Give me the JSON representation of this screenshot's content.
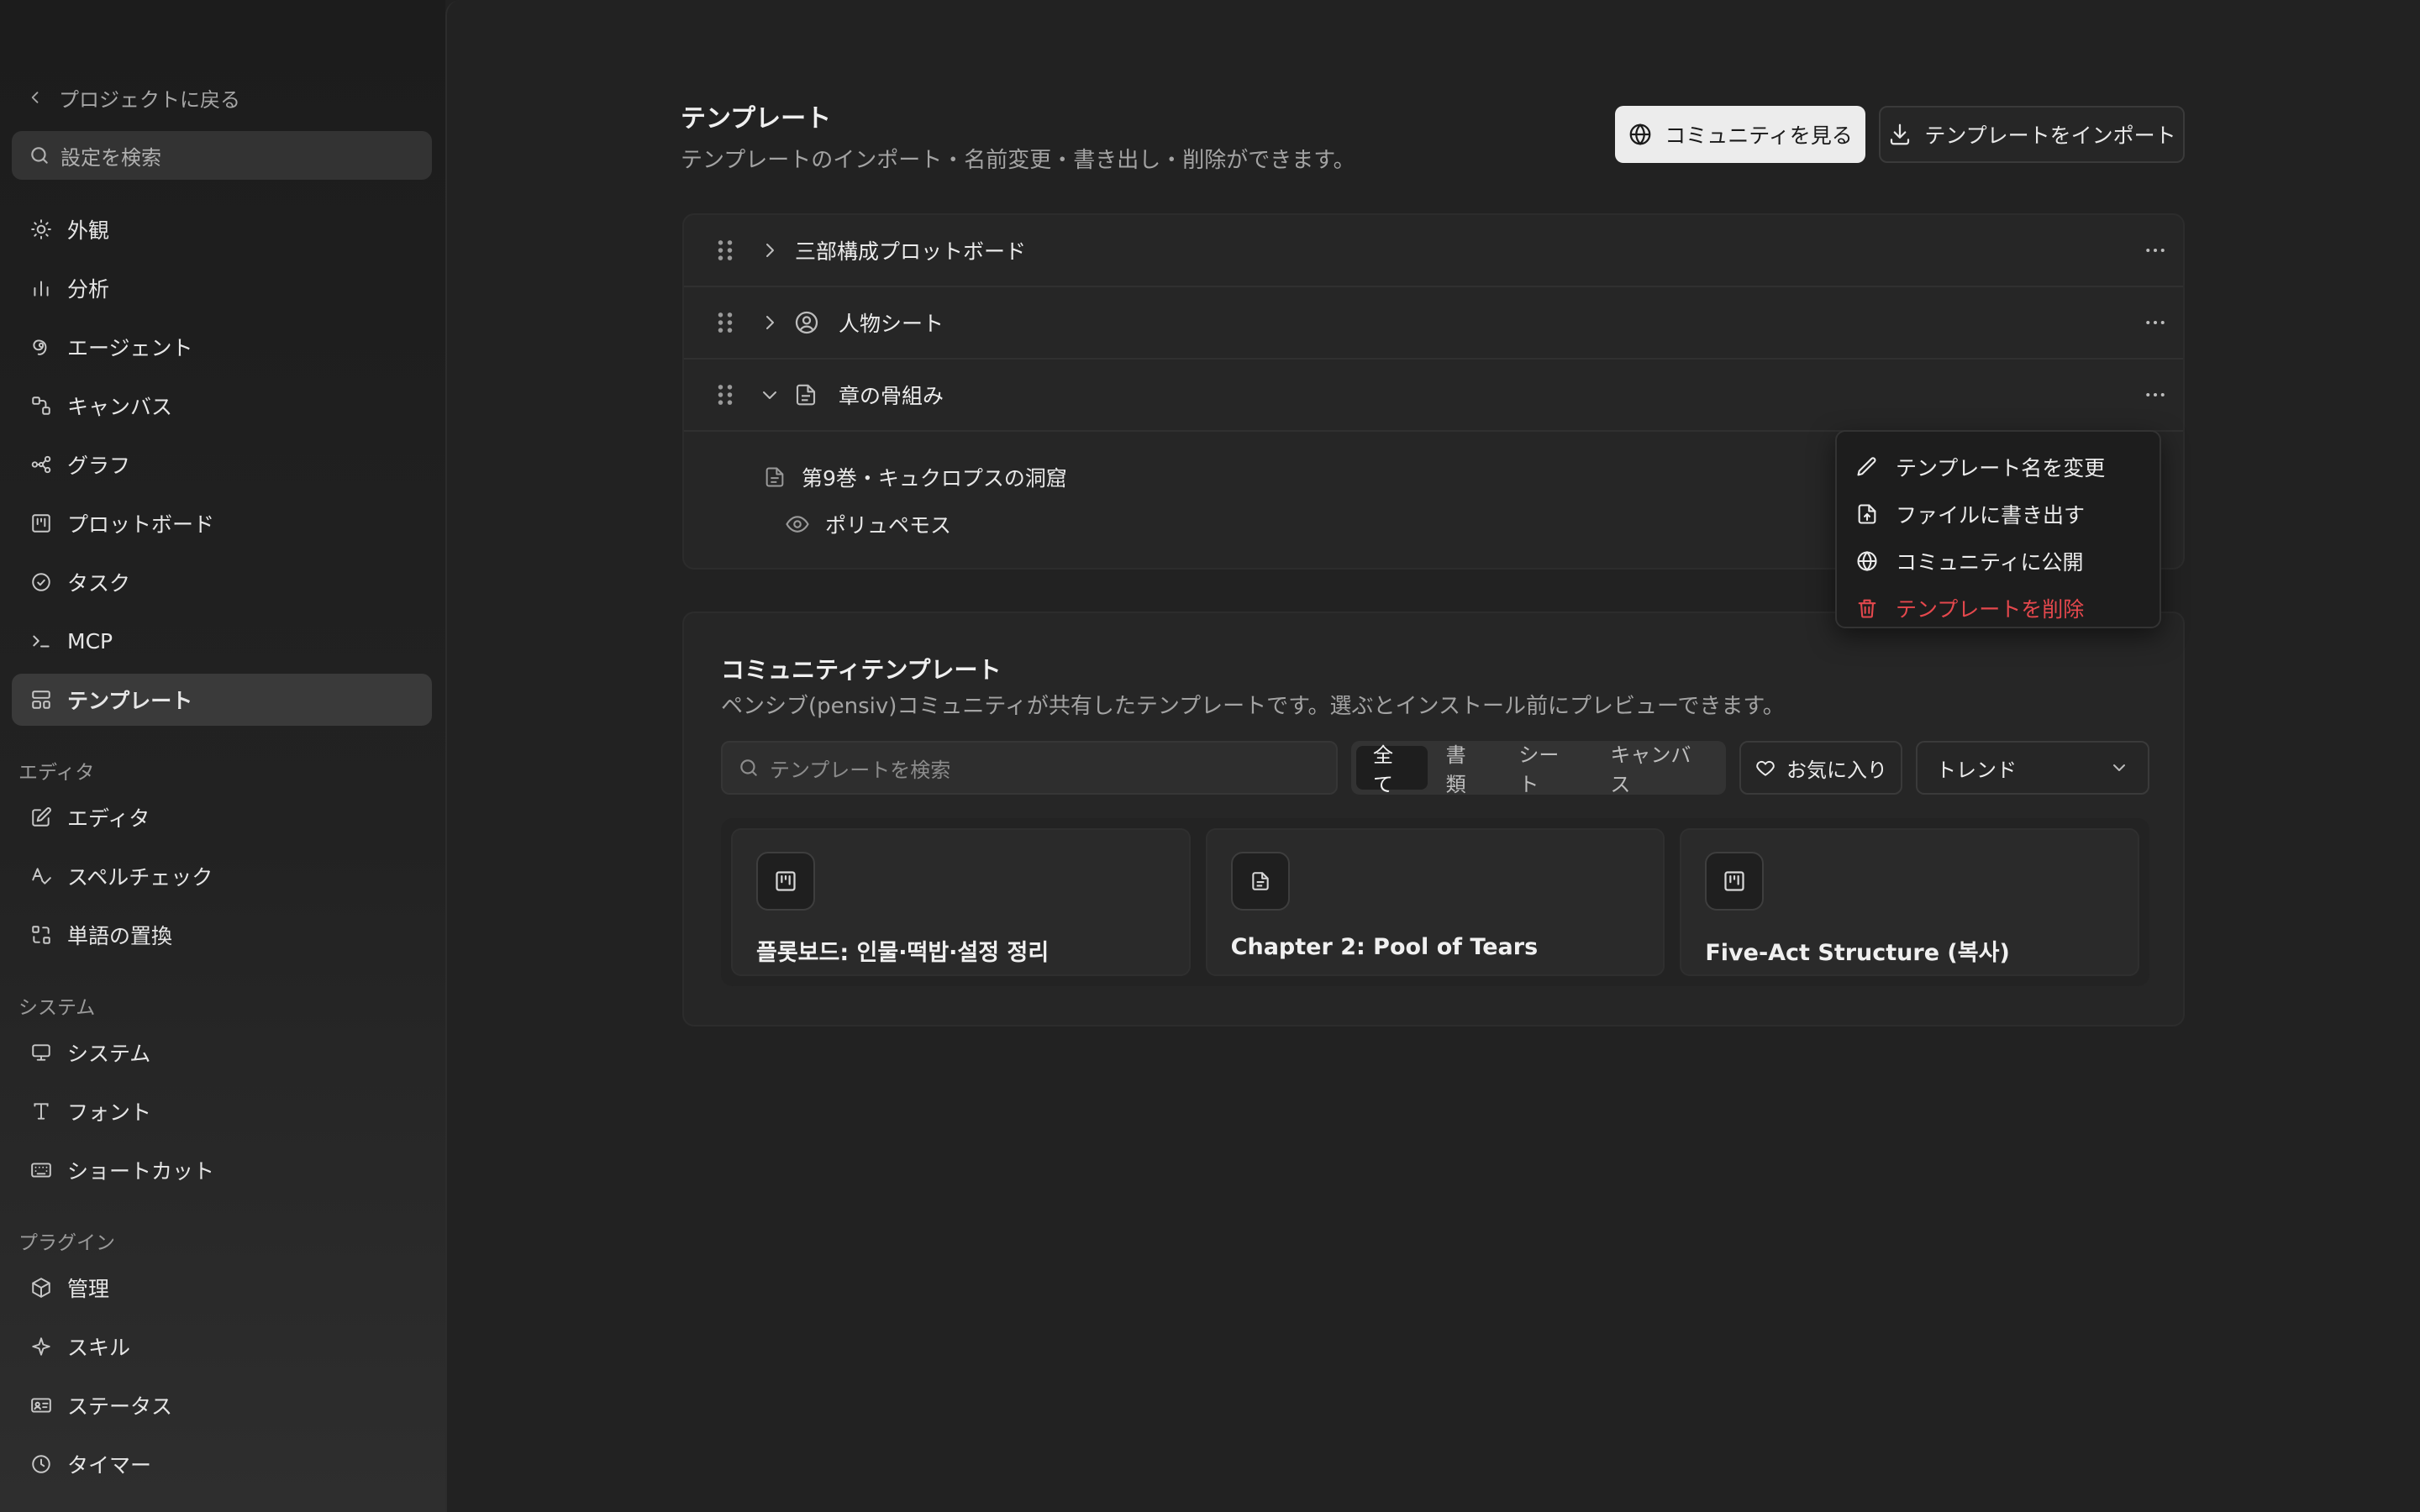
{
  "sidebar": {
    "back_label": "プロジェクトに戻る",
    "search_placeholder": "設定を検索",
    "items": [
      {
        "label": "外観",
        "icon": "sun-icon"
      },
      {
        "label": "分析",
        "icon": "bar-chart-icon"
      },
      {
        "label": "エージェント",
        "icon": "spiral-icon"
      },
      {
        "label": "キャンバス",
        "icon": "canvas-icon"
      },
      {
        "label": "グラフ",
        "icon": "graph-icon"
      },
      {
        "label": "プロットボード",
        "icon": "kanban-icon"
      },
      {
        "label": "タスク",
        "icon": "check-circle-icon"
      },
      {
        "label": "MCP",
        "icon": "terminal-icon"
      },
      {
        "label": "テンプレート",
        "icon": "layout-icon",
        "active": true
      }
    ],
    "section_editor": "エディタ",
    "editor_items": [
      {
        "label": "エディタ",
        "icon": "edit-icon"
      },
      {
        "label": "スペルチェック",
        "icon": "spellcheck-icon"
      },
      {
        "label": "単語の置換",
        "icon": "replace-icon"
      }
    ],
    "section_system": "システム",
    "system_items": [
      {
        "label": "システム",
        "icon": "monitor-icon"
      },
      {
        "label": "フォント",
        "icon": "type-icon"
      },
      {
        "label": "ショートカット",
        "icon": "keyboard-icon"
      }
    ],
    "section_plugins": "プラグイン",
    "plugin_items": [
      {
        "label": "管理",
        "icon": "package-icon"
      },
      {
        "label": "スキル",
        "icon": "sparkle-icon"
      },
      {
        "label": "ステータス",
        "icon": "id-card-icon"
      },
      {
        "label": "タイマー",
        "icon": "clock-icon"
      }
    ]
  },
  "header": {
    "title": "テンプレート",
    "subtitle": "テンプレートのインポート・名前変更・書き出し・削除ができます。",
    "community_button": "コミュニティを見る",
    "import_button": "テンプレートをインポート"
  },
  "templates": [
    {
      "name": "三部構成プロットボード",
      "expanded": false,
      "icon": ""
    },
    {
      "name": "人物シート",
      "expanded": false,
      "icon": "user-circle-icon"
    },
    {
      "name": "章の骨組み",
      "expanded": true,
      "icon": "file-icon"
    }
  ],
  "template_children": {
    "document": "第9巻・キュクロプスの洞窟",
    "character": "ポリュペモス"
  },
  "context_menu": {
    "rename": "テンプレート名を変更",
    "export": "ファイルに書き出す",
    "publish": "コミュニティに公開",
    "delete": "テンプレートを削除",
    "delete_color": "#e5484d"
  },
  "community": {
    "title": "コミュニティテンプレート",
    "subtitle": "ペンシブ(pensiv)コミュニティが共有したテンプレートです。選ぶとインストール前にプレビューできます。",
    "search_placeholder": "テンプレートを検索",
    "filters": [
      "全て",
      "書類",
      "シート",
      "キャンバス"
    ],
    "active_filter": "全て",
    "favorites_label": "お気に入り",
    "sort_value": "トレンド",
    "cards": [
      {
        "title": "플롯보드: 인물·떡밥·설정 정리",
        "icon": "kanban-icon"
      },
      {
        "title": "Chapter 2: Pool of Tears",
        "icon": "file-text-icon"
      },
      {
        "title": "Five-Act Structure (복사)",
        "icon": "kanban-icon"
      }
    ]
  }
}
